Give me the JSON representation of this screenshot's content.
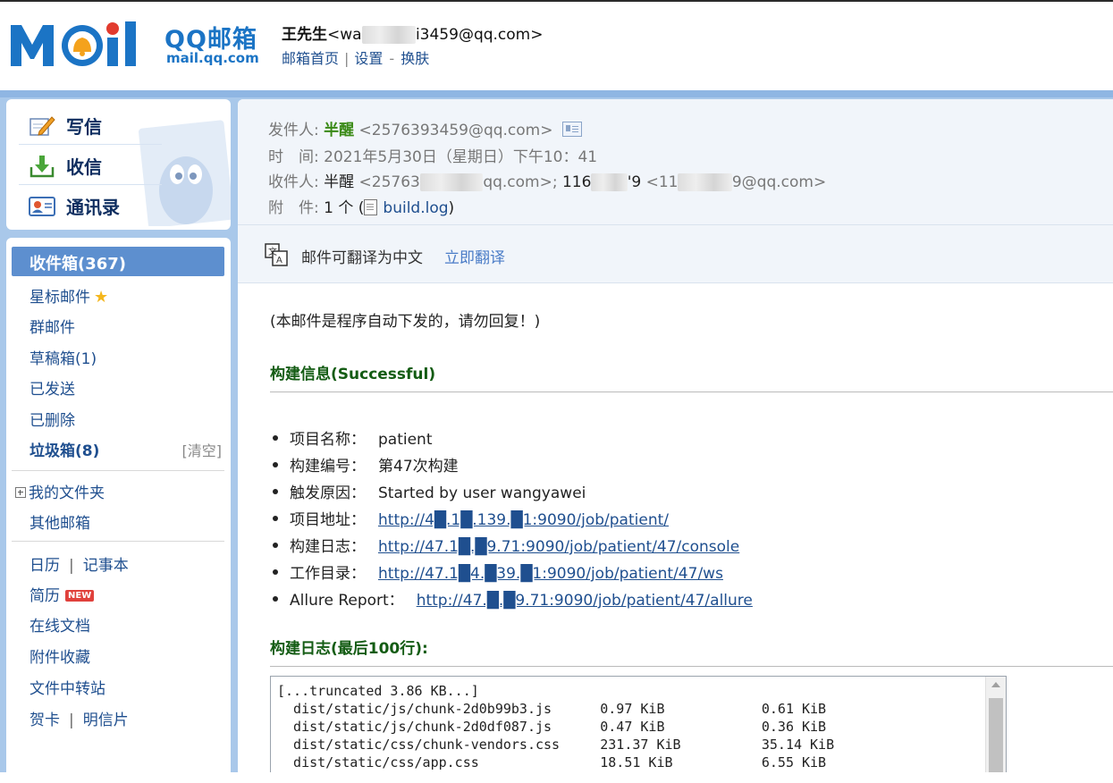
{
  "header": {
    "logo_text": "QQ邮箱",
    "logo_url": "mail.qq.com",
    "user_name": "王先生",
    "user_email_a": "<wa",
    "user_email_b": "i3459@qq.com>",
    "link_home": "邮箱首页",
    "link_settings": "设置",
    "link_dash": "-",
    "link_skin": "换肤"
  },
  "quick_actions": {
    "compose": "写信",
    "receive": "收信",
    "contacts": "通讯录"
  },
  "folders": {
    "inbox": "收件箱(367)",
    "starred": "星标邮件",
    "group": "群邮件",
    "drafts": "草稿箱(1)",
    "sent": "已发送",
    "deleted": "已删除",
    "spam": "垃圾箱(8)",
    "spam_clear": "[清空]",
    "my_folders": "我的文件夹",
    "other_mail": "其他邮箱",
    "calendar": "日历",
    "notepad": "记事本",
    "resume": "简历",
    "resume_badge": "NEW",
    "docs": "在线文档",
    "attachments": "附件收藏",
    "transfer": "文件中转站",
    "greeting": "贺卡",
    "postcard": "明信片"
  },
  "mail": {
    "from_label": "发件人:",
    "from_name": "半醒",
    "from_email": "<2576393459@qq.com>",
    "time_label": "时　间:",
    "time_value": "2021年5月30日（星期日）下午10：41",
    "to_label": "收件人:",
    "to_name1": "半醒",
    "to_email1_a": "<25763",
    "to_email1_b": "qq.com>;",
    "to_name2_a": "116",
    "to_name2_b": "'9",
    "to_email2_a": "<11",
    "to_email2_b": "9@qq.com>",
    "attach_label": "附　件:",
    "attach_count": "1 个 (",
    "attach_file": "build.log",
    "attach_close": ")"
  },
  "translate": {
    "text": "邮件可翻译为中文",
    "action": "立即翻译"
  },
  "body": {
    "note": "(本邮件是程序自动下发的，请勿回复！)",
    "build_info_title": "构建信息(Successful)",
    "items": [
      {
        "label": "项目名称：",
        "value": "patient",
        "is_link": false
      },
      {
        "label": "构建编号：",
        "value": "第47次构建",
        "is_link": false
      },
      {
        "label": "触发原因：",
        "value": "Started by user wangyawei",
        "is_link": false
      },
      {
        "label": "项目地址：",
        "value": "http://4█.1█.139.█1:9090/job/patient/",
        "is_link": true
      },
      {
        "label": "构建日志：",
        "value": "http://47.1█.█9.71:9090/job/patient/47/console",
        "is_link": true
      },
      {
        "label": "工作目录：",
        "value": "http://47.1█4.█39.█1:9090/job/patient/47/ws",
        "is_link": true
      },
      {
        "label": "Allure Report：",
        "value": "http://47.█.█9.71:9090/job/patient/47/allure",
        "is_link": true
      }
    ],
    "log_title": "构建日志(最后100行):",
    "log_lines": [
      "[...truncated 3.86 KB...]",
      "  dist/static/js/chunk-2d0b99b3.js      0.97 KiB            0.61 KiB",
      "  dist/static/js/chunk-2d0df087.js      0.47 KiB            0.36 KiB",
      "  dist/static/css/chunk-vendors.css     231.37 KiB          35.14 KiB",
      "  dist/static/css/app.css               18.51 KiB           6.55 KiB"
    ]
  },
  "colors": {
    "frame_blue": "#a9c8ea",
    "inbox_highlight": "#5d8fcf",
    "link_blue": "#1f4f8f",
    "section_green": "#145c14",
    "sender_green": "#3a8a16"
  }
}
